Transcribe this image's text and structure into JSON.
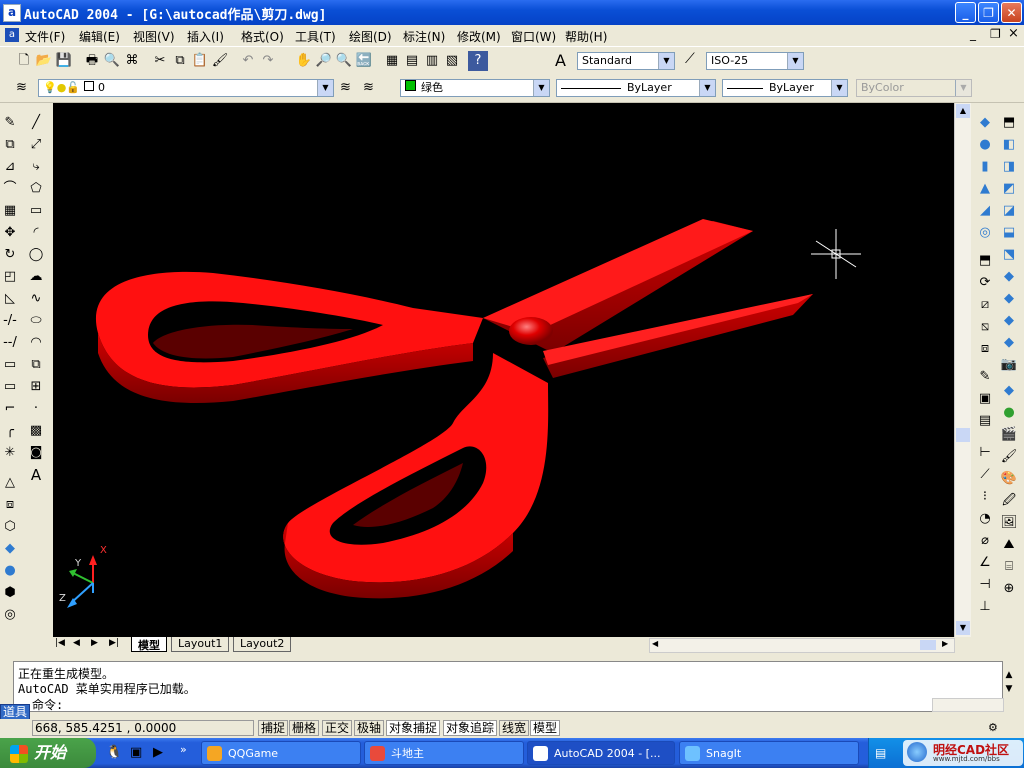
{
  "window": {
    "title": "AutoCAD 2004 - [G:\\autocad作品\\剪刀.dwg]",
    "app_icon_glyph": "a",
    "minimize_glyph": "_",
    "maximize_glyph": "❐",
    "close_glyph": "✕"
  },
  "menu": {
    "items": [
      "文件(F)",
      "编辑(E)",
      "视图(V)",
      "插入(I)",
      "格式(O)",
      "工具(T)",
      "绘图(D)",
      "标注(N)",
      "修改(M)",
      "窗口(W)",
      "帮助(H)"
    ],
    "doc_minimize": "_",
    "doc_restore": "❐",
    "doc_close": "×"
  },
  "toolbar": {
    "text_style": "Standard",
    "dim_style": "ISO-25",
    "layer": "0",
    "color": "绿色",
    "linetype": "ByLayer",
    "lineweight": "ByLayer",
    "plotstyle": "ByColor"
  },
  "canvas": {
    "background": "#000000",
    "object_color": "#ff0000",
    "ucs_x": "X",
    "ucs_y": "Y",
    "ucs_z": "Z"
  },
  "layout_tabs": [
    "模型",
    "Layout1",
    "Layout2"
  ],
  "command": {
    "lines": [
      "正在重生成模型。",
      "AutoCAD 菜单实用程序已加载。"
    ],
    "prompt": "命令:"
  },
  "status": {
    "coordinates": "668,  585.4251 , 0.0000",
    "toggles": [
      "捕捉",
      "栅格",
      "正交",
      "极轴",
      "对象捕捉",
      "对象追踪",
      "线宽",
      "模型"
    ]
  },
  "side_tab": "道具",
  "taskbar": {
    "start_label": "开始",
    "tasks": [
      "QQGame",
      "斗地主",
      "AutoCAD 2004 - [...",
      "SnagIt"
    ],
    "active_task": 2,
    "watermark": "明经CAD社区",
    "watermark_url": "www.mjtd.com/bbs"
  }
}
